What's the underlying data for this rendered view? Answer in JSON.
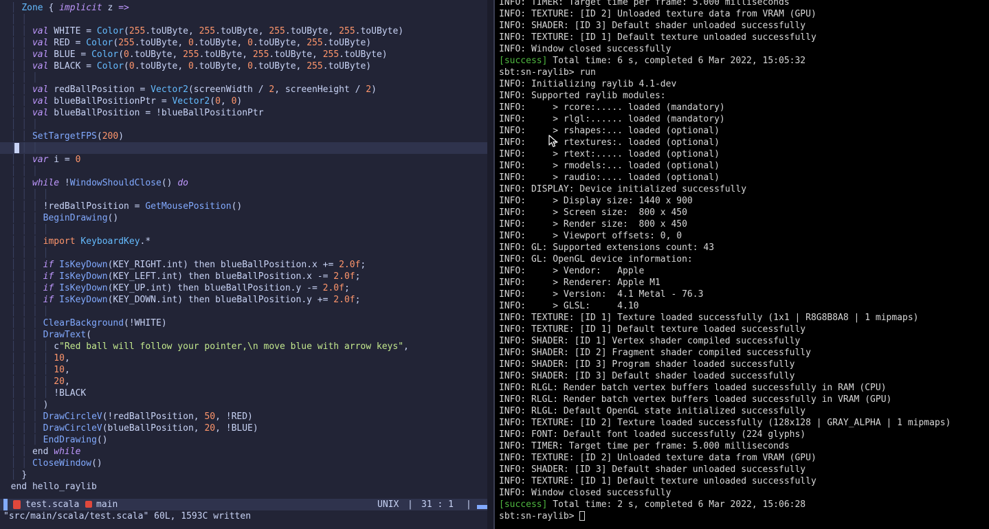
{
  "colors": {
    "editor_bg": "#222436",
    "cursorline_bg": "#2f334d",
    "keyword": "#c099ff",
    "function": "#82aaff",
    "type": "#65bcff",
    "number": "#ff966c",
    "string": "#c3e88d",
    "terminal_bg": "#000000",
    "success": "#4fb840"
  },
  "editor": {
    "lines": [
      [
        {
          "c": "g",
          "t": "  │ "
        },
        {
          "c": "t",
          "t": "Zone"
        },
        {
          "c": "p",
          "t": " { "
        },
        {
          "c": "k",
          "t": "implicit"
        },
        {
          "c": "p",
          "t": " z "
        },
        {
          "c": "k",
          "t": "=>"
        }
      ],
      [
        {
          "c": "g",
          "t": "  │ │"
        }
      ],
      [
        {
          "c": "g",
          "t": "  │ │ "
        },
        {
          "c": "k",
          "t": "val"
        },
        {
          "c": "p",
          "t": " WHITE = "
        },
        {
          "c": "t",
          "t": "Color"
        },
        {
          "c": "p",
          "t": "("
        },
        {
          "c": "n",
          "t": "255"
        },
        {
          "c": "p",
          "t": ".toUByte, "
        },
        {
          "c": "n",
          "t": "255"
        },
        {
          "c": "p",
          "t": ".toUByte, "
        },
        {
          "c": "n",
          "t": "255"
        },
        {
          "c": "p",
          "t": ".toUByte, "
        },
        {
          "c": "n",
          "t": "255"
        },
        {
          "c": "p",
          "t": ".toUByte)"
        }
      ],
      [
        {
          "c": "g",
          "t": "  │ │ "
        },
        {
          "c": "k",
          "t": "val"
        },
        {
          "c": "p",
          "t": " RED = "
        },
        {
          "c": "t",
          "t": "Color"
        },
        {
          "c": "p",
          "t": "("
        },
        {
          "c": "n",
          "t": "255"
        },
        {
          "c": "p",
          "t": ".toUByte, "
        },
        {
          "c": "n",
          "t": "0"
        },
        {
          "c": "p",
          "t": ".toUByte, "
        },
        {
          "c": "n",
          "t": "0"
        },
        {
          "c": "p",
          "t": ".toUByte, "
        },
        {
          "c": "n",
          "t": "255"
        },
        {
          "c": "p",
          "t": ".toUByte)"
        }
      ],
      [
        {
          "c": "g",
          "t": "  │ │ "
        },
        {
          "c": "k",
          "t": "val"
        },
        {
          "c": "p",
          "t": " BLUE = "
        },
        {
          "c": "t",
          "t": "Color"
        },
        {
          "c": "p",
          "t": "("
        },
        {
          "c": "n",
          "t": "0"
        },
        {
          "c": "p",
          "t": ".toUByte, "
        },
        {
          "c": "n",
          "t": "255"
        },
        {
          "c": "p",
          "t": ".toUByte, "
        },
        {
          "c": "n",
          "t": "255"
        },
        {
          "c": "p",
          "t": ".toUByte, "
        },
        {
          "c": "n",
          "t": "255"
        },
        {
          "c": "p",
          "t": ".toUByte)"
        }
      ],
      [
        {
          "c": "g",
          "t": "  │ │ "
        },
        {
          "c": "k",
          "t": "val"
        },
        {
          "c": "p",
          "t": " BLACK = "
        },
        {
          "c": "t",
          "t": "Color"
        },
        {
          "c": "p",
          "t": "("
        },
        {
          "c": "n",
          "t": "0"
        },
        {
          "c": "p",
          "t": ".toUByte, "
        },
        {
          "c": "n",
          "t": "0"
        },
        {
          "c": "p",
          "t": ".toUByte, "
        },
        {
          "c": "n",
          "t": "0"
        },
        {
          "c": "p",
          "t": ".toUByte, "
        },
        {
          "c": "n",
          "t": "255"
        },
        {
          "c": "p",
          "t": ".toUByte)"
        }
      ],
      [
        {
          "c": "g",
          "t": "  │ │ │"
        }
      ],
      [
        {
          "c": "g",
          "t": "  │ │ "
        },
        {
          "c": "k",
          "t": "val"
        },
        {
          "c": "p",
          "t": " redBallPosition = "
        },
        {
          "c": "t",
          "t": "Vector2"
        },
        {
          "c": "p",
          "t": "(screenWidth / "
        },
        {
          "c": "n",
          "t": "2"
        },
        {
          "c": "p",
          "t": ", screenHeight / "
        },
        {
          "c": "n",
          "t": "2"
        },
        {
          "c": "p",
          "t": ")"
        }
      ],
      [
        {
          "c": "g",
          "t": "  │ │ "
        },
        {
          "c": "k",
          "t": "val"
        },
        {
          "c": "p",
          "t": " blueBallPositionPtr = "
        },
        {
          "c": "t",
          "t": "Vector2"
        },
        {
          "c": "p",
          "t": "("
        },
        {
          "c": "n",
          "t": "0"
        },
        {
          "c": "p",
          "t": ", "
        },
        {
          "c": "n",
          "t": "0"
        },
        {
          "c": "p",
          "t": ")"
        }
      ],
      [
        {
          "c": "g",
          "t": "  │ │ "
        },
        {
          "c": "k",
          "t": "val"
        },
        {
          "c": "p",
          "t": " blueBallPosition = !blueBallPositionPtr"
        }
      ],
      [
        {
          "c": "g",
          "t": "  │ │ │"
        }
      ],
      [
        {
          "c": "g",
          "t": "  │ │ "
        },
        {
          "c": "f",
          "t": "SetTargetFPS"
        },
        {
          "c": "p",
          "t": "("
        },
        {
          "c": "n",
          "t": "200"
        },
        {
          "c": "p",
          "t": ")"
        }
      ],
      [
        {
          "c": "g",
          "t": "  │ │ │"
        }
      ],
      [
        {
          "c": "g",
          "t": "  │ │ "
        },
        {
          "c": "k",
          "t": "var"
        },
        {
          "c": "p",
          "t": " i = "
        },
        {
          "c": "n",
          "t": "0"
        }
      ],
      [
        {
          "c": "g",
          "t": "  │ │ │"
        }
      ],
      [
        {
          "c": "g",
          "t": "  │ │ "
        },
        {
          "c": "k",
          "t": "while"
        },
        {
          "c": "p",
          "t": " !"
        },
        {
          "c": "f",
          "t": "WindowShouldClose"
        },
        {
          "c": "p",
          "t": "() "
        },
        {
          "c": "k",
          "t": "do"
        }
      ],
      [
        {
          "c": "g",
          "t": "  │ │ │ │"
        }
      ],
      [
        {
          "c": "g",
          "t": "  │ │ │ "
        },
        {
          "c": "p",
          "t": "!redBallPosition = "
        },
        {
          "c": "f",
          "t": "GetMousePosition"
        },
        {
          "c": "p",
          "t": "()"
        }
      ],
      [
        {
          "c": "g",
          "t": "  │ │ │ "
        },
        {
          "c": "f",
          "t": "BeginDrawing"
        },
        {
          "c": "p",
          "t": "()"
        }
      ],
      [
        {
          "c": "g",
          "t": "  │ │ │ │"
        }
      ],
      [
        {
          "c": "g",
          "t": "  │ │ │ "
        },
        {
          "c": "kr",
          "t": "import"
        },
        {
          "c": "p",
          "t": " "
        },
        {
          "c": "t",
          "t": "KeyboardKey"
        },
        {
          "c": "p",
          "t": ".*"
        }
      ],
      [
        {
          "c": "g",
          "t": "  │ │ │ │"
        }
      ],
      [
        {
          "c": "g",
          "t": "  │ │ │ "
        },
        {
          "c": "k",
          "t": "if"
        },
        {
          "c": "p",
          "t": " "
        },
        {
          "c": "f",
          "t": "IsKeyDown"
        },
        {
          "c": "p",
          "t": "(KEY_RIGHT.int) then blueBallPosition.x += "
        },
        {
          "c": "n",
          "t": "2.0f"
        },
        {
          "c": "p",
          "t": ";"
        }
      ],
      [
        {
          "c": "g",
          "t": "  │ │ │ "
        },
        {
          "c": "k",
          "t": "if"
        },
        {
          "c": "p",
          "t": " "
        },
        {
          "c": "f",
          "t": "IsKeyDown"
        },
        {
          "c": "p",
          "t": "(KEY_LEFT.int) then blueBallPosition.x -= "
        },
        {
          "c": "n",
          "t": "2.0f"
        },
        {
          "c": "p",
          "t": ";"
        }
      ],
      [
        {
          "c": "g",
          "t": "  │ │ │ "
        },
        {
          "c": "k",
          "t": "if"
        },
        {
          "c": "p",
          "t": " "
        },
        {
          "c": "f",
          "t": "IsKeyDown"
        },
        {
          "c": "p",
          "t": "(KEY_UP.int) then blueBallPosition.y -= "
        },
        {
          "c": "n",
          "t": "2.0f"
        },
        {
          "c": "p",
          "t": ";"
        }
      ],
      [
        {
          "c": "g",
          "t": "  │ │ │ "
        },
        {
          "c": "k",
          "t": "if"
        },
        {
          "c": "p",
          "t": " "
        },
        {
          "c": "f",
          "t": "IsKeyDown"
        },
        {
          "c": "p",
          "t": "(KEY_DOWN.int) then blueBallPosition.y += "
        },
        {
          "c": "n",
          "t": "2.0f"
        },
        {
          "c": "p",
          "t": ";"
        }
      ],
      [
        {
          "c": "g",
          "t": "  │ │ │ │"
        }
      ],
      [
        {
          "c": "g",
          "t": "  │ │ │ "
        },
        {
          "c": "f",
          "t": "ClearBackground"
        },
        {
          "c": "p",
          "t": "(!WHITE)"
        }
      ],
      [
        {
          "c": "g",
          "t": "  │ │ │ "
        },
        {
          "c": "f",
          "t": "DrawText"
        },
        {
          "c": "p",
          "t": "("
        }
      ],
      [
        {
          "c": "g",
          "t": "  │ │ │ │ "
        },
        {
          "c": "p",
          "t": "c"
        },
        {
          "c": "s",
          "t": "\"Red ball will follow your pointer,\\n move blue with arrow keys\""
        },
        {
          "c": "p",
          "t": ","
        }
      ],
      [
        {
          "c": "g",
          "t": "  │ │ │ │ "
        },
        {
          "c": "n",
          "t": "10"
        },
        {
          "c": "p",
          "t": ","
        }
      ],
      [
        {
          "c": "g",
          "t": "  │ │ │ │ "
        },
        {
          "c": "n",
          "t": "10"
        },
        {
          "c": "p",
          "t": ","
        }
      ],
      [
        {
          "c": "g",
          "t": "  │ │ │ │ "
        },
        {
          "c": "n",
          "t": "20"
        },
        {
          "c": "p",
          "t": ","
        }
      ],
      [
        {
          "c": "g",
          "t": "  │ │ │ │ "
        },
        {
          "c": "p",
          "t": "!BLACK"
        }
      ],
      [
        {
          "c": "g",
          "t": "  │ │ │ "
        },
        {
          "c": "p",
          "t": ")"
        }
      ],
      [
        {
          "c": "g",
          "t": "  │ │ │ "
        },
        {
          "c": "f",
          "t": "DrawCircleV"
        },
        {
          "c": "p",
          "t": "(!redBallPosition, "
        },
        {
          "c": "n",
          "t": "50"
        },
        {
          "c": "p",
          "t": ", !RED)"
        }
      ],
      [
        {
          "c": "g",
          "t": "  │ │ │ "
        },
        {
          "c": "f",
          "t": "DrawCircleV"
        },
        {
          "c": "p",
          "t": "(blueBallPosition, "
        },
        {
          "c": "n",
          "t": "20"
        },
        {
          "c": "p",
          "t": ", !BLUE)"
        }
      ],
      [
        {
          "c": "g",
          "t": "  │ │ │ "
        },
        {
          "c": "f",
          "t": "EndDrawing"
        },
        {
          "c": "p",
          "t": "()"
        }
      ],
      [
        {
          "c": "g",
          "t": "  │ │ "
        },
        {
          "c": "p",
          "t": "end "
        },
        {
          "c": "k",
          "t": "while"
        }
      ],
      [
        {
          "c": "g",
          "t": "  │ │ "
        },
        {
          "c": "f",
          "t": "CloseWindow"
        },
        {
          "c": "p",
          "t": "()"
        }
      ],
      [
        {
          "c": "g",
          "t": "  │ "
        },
        {
          "c": "p",
          "t": "}"
        }
      ],
      [
        {
          "c": "p",
          "t": "  end hello_raylib"
        }
      ]
    ],
    "cursor_line_index": 12
  },
  "statusline": {
    "filename": "test.scala",
    "branch": "main",
    "fileformat": "UNIX",
    "separator": "|",
    "position": "31 : 1",
    "filetype_icon": "scala-icon",
    "branch_icon": "git-branch-icon"
  },
  "cmdline": {
    "message": "\"src/main/scala/test.scala\" 60L, 1593C written"
  },
  "terminal": {
    "lines": [
      [
        {
          "t": "INFO: TIMER: Target time per frame: 5.000 milliseconds"
        }
      ],
      [
        {
          "t": "INFO: TEXTURE: [ID 2] Unloaded texture data from VRAM (GPU)"
        }
      ],
      [
        {
          "t": "INFO: SHADER: [ID 3] Default shader unloaded successfully"
        }
      ],
      [
        {
          "t": "INFO: TEXTURE: [ID 1] Default texture unloaded successfully"
        }
      ],
      [
        {
          "t": "INFO: Window closed successfully"
        }
      ],
      [
        {
          "c": "ok",
          "t": "[success]"
        },
        {
          "t": " Total time: 6 s, completed 6 Mar 2022, 15:05:32"
        }
      ],
      [
        {
          "t": "sbt:sn-raylib> run"
        }
      ],
      [
        {
          "t": "INFO: Initializing raylib 4.1-dev"
        }
      ],
      [
        {
          "t": "INFO: Supported raylib modules:"
        }
      ],
      [
        {
          "t": "INFO:     > rcore:..... loaded (mandatory)"
        }
      ],
      [
        {
          "t": "INFO:     > rlgl:...... loaded (mandatory)"
        }
      ],
      [
        {
          "t": "INFO:     > rshapes:... loaded (optional)"
        }
      ],
      [
        {
          "t": "INFO:     > rtextures:. loaded (optional)"
        }
      ],
      [
        {
          "t": "INFO:     > rtext:..... loaded (optional)"
        }
      ],
      [
        {
          "t": "INFO:     > rmodels:... loaded (optional)"
        }
      ],
      [
        {
          "t": "INFO:     > raudio:.... loaded (optional)"
        }
      ],
      [
        {
          "t": "INFO: DISPLAY: Device initialized successfully"
        }
      ],
      [
        {
          "t": "INFO:     > Display size: 1440 x 900"
        }
      ],
      [
        {
          "t": "INFO:     > Screen size:  800 x 450"
        }
      ],
      [
        {
          "t": "INFO:     > Render size:  800 x 450"
        }
      ],
      [
        {
          "t": "INFO:     > Viewport offsets: 0, 0"
        }
      ],
      [
        {
          "t": "INFO: GL: Supported extensions count: 43"
        }
      ],
      [
        {
          "t": "INFO: GL: OpenGL device information:"
        }
      ],
      [
        {
          "t": "INFO:     > Vendor:   Apple"
        }
      ],
      [
        {
          "t": "INFO:     > Renderer: Apple M1"
        }
      ],
      [
        {
          "t": "INFO:     > Version:  4.1 Metal - 76.3"
        }
      ],
      [
        {
          "t": "INFO:     > GLSL:     4.10"
        }
      ],
      [
        {
          "t": "INFO: TEXTURE: [ID 1] Texture loaded successfully (1x1 | R8G8B8A8 | 1 mipmaps)"
        }
      ],
      [
        {
          "t": "INFO: TEXTURE: [ID 1] Default texture loaded successfully"
        }
      ],
      [
        {
          "t": "INFO: SHADER: [ID 1] Vertex shader compiled successfully"
        }
      ],
      [
        {
          "t": "INFO: SHADER: [ID 2] Fragment shader compiled successfully"
        }
      ],
      [
        {
          "t": "INFO: SHADER: [ID 3] Program shader loaded successfully"
        }
      ],
      [
        {
          "t": "INFO: SHADER: [ID 3] Default shader loaded successfully"
        }
      ],
      [
        {
          "t": "INFO: RLGL: Render batch vertex buffers loaded successfully in RAM (CPU)"
        }
      ],
      [
        {
          "t": "INFO: RLGL: Render batch vertex buffers loaded successfully in VRAM (GPU)"
        }
      ],
      [
        {
          "t": "INFO: RLGL: Default OpenGL state initialized successfully"
        }
      ],
      [
        {
          "t": "INFO: TEXTURE: [ID 2] Texture loaded successfully (128x128 | GRAY_ALPHA | 1 mipmaps)"
        }
      ],
      [
        {
          "t": "INFO: FONT: Default font loaded successfully (224 glyphs)"
        }
      ],
      [
        {
          "t": "INFO: TIMER: Target time per frame: 5.000 milliseconds"
        }
      ],
      [
        {
          "t": "INFO: TEXTURE: [ID 2] Unloaded texture data from VRAM (GPU)"
        }
      ],
      [
        {
          "t": "INFO: SHADER: [ID 3] Default shader unloaded successfully"
        }
      ],
      [
        {
          "t": "INFO: TEXTURE: [ID 1] Default texture unloaded successfully"
        }
      ],
      [
        {
          "t": "INFO: Window closed successfully"
        }
      ],
      [
        {
          "c": "ok",
          "t": "[success]"
        },
        {
          "t": " Total time: 2 s, completed 6 Mar 2022, 15:06:28"
        }
      ]
    ],
    "prompt": "sbt:sn-raylib> "
  },
  "pointer_icon": "mouse-pointer-icon"
}
